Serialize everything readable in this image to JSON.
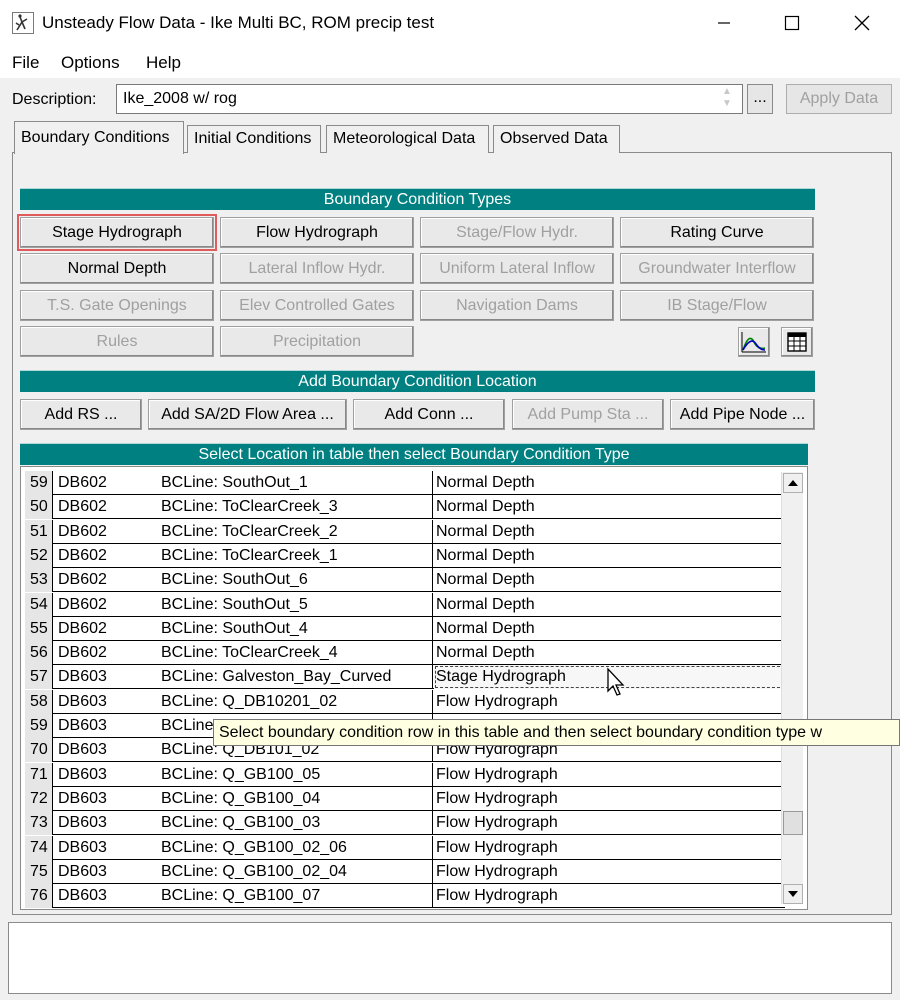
{
  "window": {
    "title": "Unsteady Flow Data - Ike Multi BC, ROM precip test",
    "app_icon": "hec-ras-app-icon",
    "controls": [
      "minimize-icon",
      "maximize-icon",
      "close-icon"
    ]
  },
  "menu": {
    "file": "File",
    "options": "Options",
    "help": "Help"
  },
  "description": {
    "label": "Description:",
    "value": "Ike_2008 w/ rog",
    "ellipsis": "...",
    "apply": "Apply Data"
  },
  "tabs": {
    "boundary": "Boundary Conditions",
    "initial": "Initial Conditions",
    "meteorological": "Meteorological Data",
    "observed": "Observed Data"
  },
  "bc_types": {
    "header": "Boundary Condition Types",
    "stage_hydrograph": "Stage Hydrograph",
    "flow_hydrograph": "Flow Hydrograph",
    "stage_flow_hydr": "Stage/Flow Hydr.",
    "rating_curve": "Rating Curve",
    "normal_depth": "Normal Depth",
    "lateral_inflow": "Lateral Inflow Hydr.",
    "uniform_lateral": "Uniform Lateral Inflow",
    "groundwater": "Groundwater Interflow",
    "ts_gate": "T.S. Gate Openings",
    "elev_gates": "Elev Controlled Gates",
    "nav_dams": "Navigation Dams",
    "ib_stage_flow": "IB Stage/Flow",
    "rules": "Rules",
    "precipitation": "Precipitation",
    "plot_icon": "plot-graph-icon",
    "table_icon": "table-grid-icon"
  },
  "add_location": {
    "header": "Add Boundary Condition Location",
    "add_rs": "Add RS ...",
    "add_sa": "Add SA/2D Flow Area ...",
    "add_conn": "Add Conn ...",
    "add_pump": "Add Pump Sta ...",
    "add_pipe": "Add Pipe Node ..."
  },
  "table": {
    "header": "Select Location in table then select Boundary Condition Type",
    "rows": [
      {
        "num": "59",
        "loc1": "DB602",
        "loc2": "BCLine: SouthOut_1",
        "type": "Normal Depth"
      },
      {
        "num": "50",
        "loc1": "DB602",
        "loc2": "BCLine: ToClearCreek_3",
        "type": "Normal Depth"
      },
      {
        "num": "51",
        "loc1": "DB602",
        "loc2": "BCLine: ToClearCreek_2",
        "type": "Normal Depth"
      },
      {
        "num": "52",
        "loc1": "DB602",
        "loc2": "BCLine: ToClearCreek_1",
        "type": "Normal Depth"
      },
      {
        "num": "53",
        "loc1": "DB602",
        "loc2": "BCLine: SouthOut_6",
        "type": "Normal Depth"
      },
      {
        "num": "54",
        "loc1": "DB602",
        "loc2": "BCLine: SouthOut_5",
        "type": "Normal Depth"
      },
      {
        "num": "55",
        "loc1": "DB602",
        "loc2": "BCLine: SouthOut_4",
        "type": "Normal Depth"
      },
      {
        "num": "56",
        "loc1": "DB602",
        "loc2": "BCLine: ToClearCreek_4",
        "type": "Normal Depth"
      },
      {
        "num": "57",
        "loc1": "DB603",
        "loc2": "BCLine: Galveston_Bay_Curved",
        "type": "Stage Hydrograph"
      },
      {
        "num": "58",
        "loc1": "DB603",
        "loc2": "BCLine: Q_DB10201_02",
        "type": "Flow Hydrograph"
      },
      {
        "num": "59",
        "loc1": "DB603",
        "loc2": "BCLine:",
        "type": ""
      },
      {
        "num": "70",
        "loc1": "DB603",
        "loc2": "BCLine: Q_DB101_02",
        "type": "Flow Hydrograph"
      },
      {
        "num": "71",
        "loc1": "DB603",
        "loc2": "BCLine: Q_GB100_05",
        "type": "Flow Hydrograph"
      },
      {
        "num": "72",
        "loc1": "DB603",
        "loc2": "BCLine: Q_GB100_04",
        "type": "Flow Hydrograph"
      },
      {
        "num": "73",
        "loc1": "DB603",
        "loc2": "BCLine: Q_GB100_03",
        "type": "Flow Hydrograph"
      },
      {
        "num": "74",
        "loc1": "DB603",
        "loc2": "BCLine: Q_GB100_02_06",
        "type": "Flow Hydrograph"
      },
      {
        "num": "75",
        "loc1": "DB603",
        "loc2": "BCLine: Q_GB100_02_04",
        "type": "Flow Hydrograph"
      },
      {
        "num": "76",
        "loc1": "DB603",
        "loc2": "BCLine: Q_GB100_07",
        "type": "Flow Hydrograph"
      }
    ]
  },
  "tooltip": "Select boundary condition row in this table and then select boundary condition type w",
  "message": ""
}
